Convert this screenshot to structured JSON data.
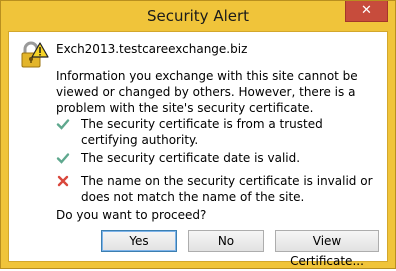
{
  "window": {
    "title": "Security Alert",
    "close_glyph": "✕"
  },
  "alert": {
    "icon": "lock-warning-icon",
    "host": "Exch2013.testcareexchange.biz",
    "info_text": "Information you exchange with this site cannot be viewed or changed by others. However, there is a problem with the site's security certificate.",
    "checks": [
      {
        "status": "ok",
        "icon": "check-icon",
        "text": "The security certificate is from a trusted certifying authority."
      },
      {
        "status": "ok",
        "icon": "check-icon",
        "text": "The security certificate date is valid."
      },
      {
        "status": "error",
        "icon": "error-x-icon",
        "text": "The name on the security certificate is invalid or does not match the name of the site."
      }
    ],
    "question": "Do you want to proceed?"
  },
  "buttons": {
    "yes": "Yes",
    "no": "No",
    "view_certificate": "View Certificate..."
  },
  "colors": {
    "frame": "#f0c43a",
    "close_button": "#c74c3c",
    "check": "#5fa88e",
    "error": "#d9473c"
  }
}
